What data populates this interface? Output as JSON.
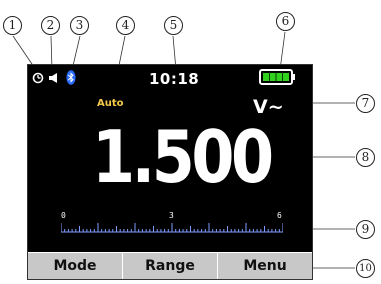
{
  "callouts": [
    "1",
    "2",
    "3",
    "4",
    "5",
    "6",
    "7",
    "8",
    "9",
    "10"
  ],
  "status_bar": {
    "icons": [
      "auto-power-off-icon",
      "speaker-icon",
      "bluetooth-icon"
    ],
    "time": "10:18",
    "battery": {
      "icon": "battery-icon",
      "level": 1.0,
      "color": "#2fd11d"
    }
  },
  "display": {
    "range_mode": "Auto",
    "unit": "V~",
    "reading": "1.500"
  },
  "bargraph": {
    "labels": [
      "0",
      "3",
      "6"
    ],
    "min": 0,
    "max": 6,
    "color": "#7f9bff"
  },
  "softkeys": {
    "mode": "Mode",
    "range": "Range",
    "menu": "Menu"
  },
  "colors": {
    "screen_bg": "#000000",
    "auto_label": "#f2c84a",
    "softkey_bg": "#c8c8c8",
    "bluetooth": "#2b6cff"
  }
}
